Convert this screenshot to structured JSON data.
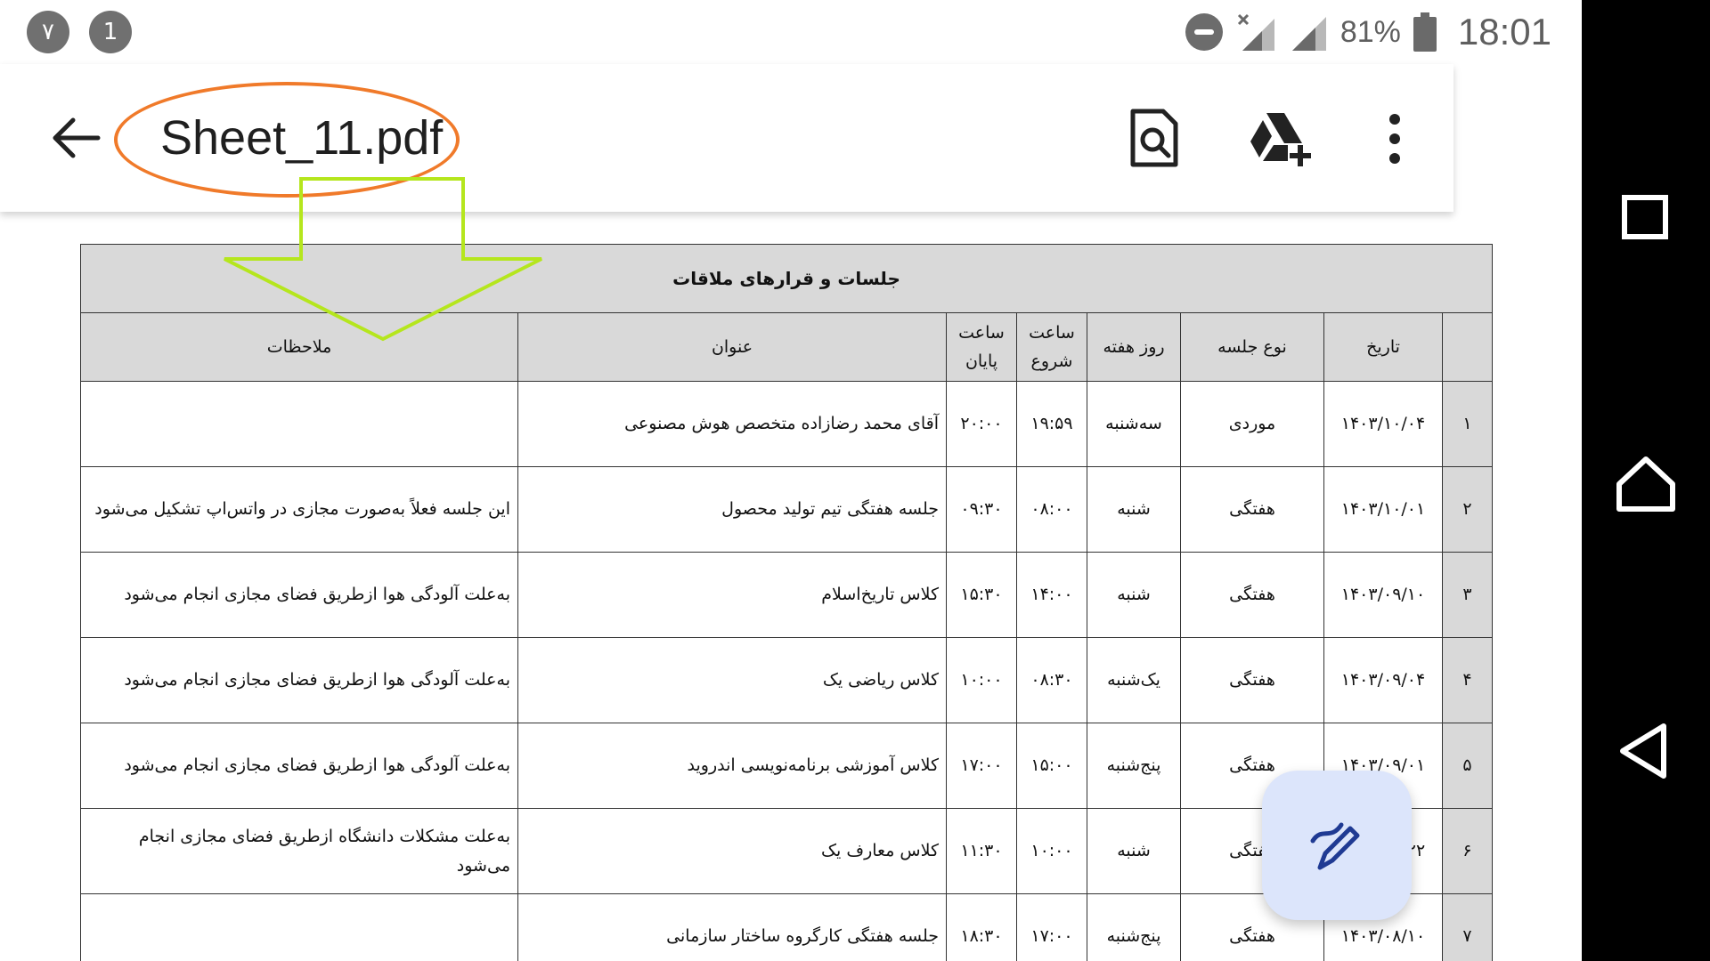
{
  "status_bar": {
    "notifications": [
      "٧",
      "1"
    ],
    "battery_percent": "81%",
    "time": "18:01"
  },
  "app_bar": {
    "title": "Sheet_11.pdf",
    "actions": [
      "search-in-document-icon",
      "add-to-drive-icon",
      "more-options-icon"
    ]
  },
  "document": {
    "table_title": "جلسات و قرارهای ملاقات",
    "headers": {
      "index": "",
      "date": "تاریخ",
      "type": "نوع جلسه",
      "day": "روز هفته",
      "start": "ساعت شروع",
      "end": "ساعت پایان",
      "title": "عنوان",
      "notes": "ملاحظات"
    },
    "rows": [
      {
        "index": "۱",
        "date": "۱۴۰۳/۱۰/۰۴",
        "type": "موردی",
        "day": "سه‌شنبه",
        "start": "۱۹:۵۹",
        "end": "۲۰:۰۰",
        "title": "آقای محمد رضازاده متخصص هوش مصنوعی",
        "notes": ""
      },
      {
        "index": "۲",
        "date": "۱۴۰۳/۱۰/۰۱",
        "type": "هفتگی",
        "day": "شنبه",
        "start": "۰۸:۰۰",
        "end": "۰۹:۳۰",
        "title": "جلسه هفتگی تیم تولید محصول",
        "notes": "این جلسه فعلاً به‌صورت مجازی در واتس‌اپ تشکیل می‌شود"
      },
      {
        "index": "۳",
        "date": "۱۴۰۳/۰۹/۱۰",
        "type": "هفتگی",
        "day": "شنبه",
        "start": "۱۴:۰۰",
        "end": "۱۵:۳۰",
        "title": "کلاس تاریخ‌اسلام",
        "notes": "به‌علت آلودگی هوا ازطریق فضای مجازی انجام می‌شود"
      },
      {
        "index": "۴",
        "date": "۱۴۰۳/۰۹/۰۴",
        "type": "هفتگی",
        "day": "یک‌شنبه",
        "start": "۰۸:۳۰",
        "end": "۱۰:۰۰",
        "title": "کلاس ریاضی یک",
        "notes": "به‌علت آلودگی هوا ازطریق فضای مجازی انجام می‌شود"
      },
      {
        "index": "۵",
        "date": "۱۴۰۳/۰۹/۰۱",
        "type": "هفتگی",
        "day": "پنج‌شنبه",
        "start": "۱۵:۰۰",
        "end": "۱۷:۰۰",
        "title": "کلاس آموزشی برنامه‌نویسی اندروید",
        "notes": "به‌علت آلودگی هوا ازطریق فضای مجازی انجام می‌شود"
      },
      {
        "index": "۶",
        "date": "۱۴۰۳/۰۸/۲۲",
        "type": "هفتگی",
        "day": "شنبه",
        "start": "۱۰:۰۰",
        "end": "۱۱:۳۰",
        "title": "کلاس معارف یک",
        "notes": "به‌علت مشکلات دانشگاه ازطریق فضای مجازی انجام می‌شود"
      },
      {
        "index": "۷",
        "date": "۱۴۰۳/۰۸/۱۰",
        "type": "هفتگی",
        "day": "پنج‌شنبه",
        "start": "۱۷:۰۰",
        "end": "۱۸:۳۰",
        "title": "جلسه هفتگی کارگروه ساختار سازمانی",
        "notes": ""
      }
    ]
  },
  "fab": {
    "icon": "edit-pen-icon"
  },
  "nav_bar": {
    "buttons": [
      "recents-square-icon",
      "home-icon",
      "back-triangle-icon"
    ]
  },
  "colors": {
    "title_oval": "#f07a2a",
    "annotation_arrow": "#b5e61d",
    "fab_background": "#dce5fb",
    "fab_icon": "#1f3a93",
    "table_header_bg": "#d9d9d9"
  }
}
